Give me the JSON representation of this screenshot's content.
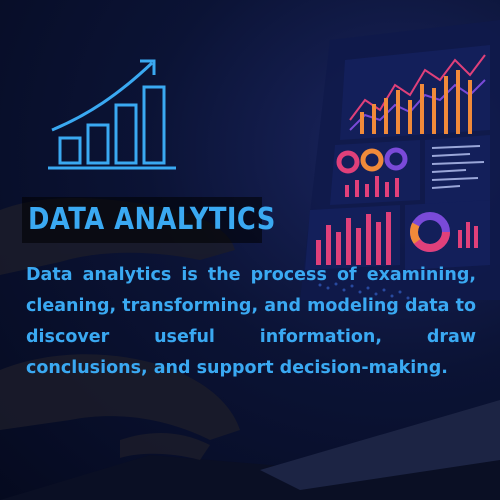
{
  "headline": "DATA ANALYTICS",
  "description": "Data analytics is the process of examining, cleaning, transforming, and modeling data to discover useful information, draw conclusions, and support decision-making.",
  "logo_icon": "bar-chart-trend-arrow-icon",
  "colors": {
    "accent": "#3aa9f2",
    "background": "#0b1335",
    "dashboard_pink": "#e0407a",
    "dashboard_orange": "#f08a3a",
    "dashboard_purple": "#7a4ad8"
  }
}
